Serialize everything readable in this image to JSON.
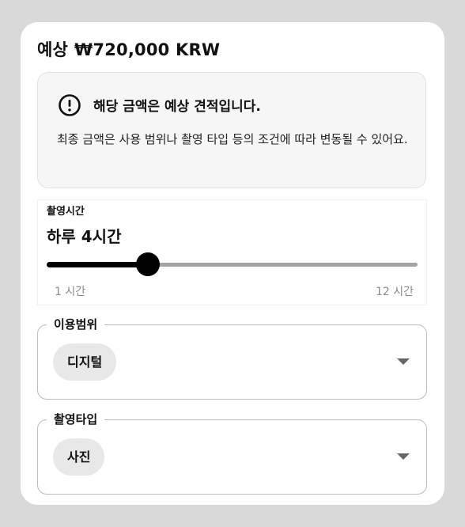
{
  "estimate": {
    "label": "예상",
    "price": "₩720,000 KRW"
  },
  "notice": {
    "icon": "exclamation-circle-icon",
    "title": "해당 금액은 예상 견적입니다.",
    "body": "최종 금액은 사용 범위나 촬영 타입 등의 조건에 따라 변동될 수 있어요."
  },
  "shooting_time": {
    "label": "촬영시간",
    "value": "하루 4시간",
    "slider": {
      "min_label": "1 시간",
      "max_label": "12 시간",
      "min": 1,
      "max": 12,
      "current": 4
    }
  },
  "usage": {
    "legend": "이용범위",
    "selected": "디지털",
    "caret_icon": "caret-down-icon"
  },
  "shoot_type": {
    "legend": "촬영타입",
    "selected": "사진",
    "caret_icon": "caret-down-icon"
  }
}
